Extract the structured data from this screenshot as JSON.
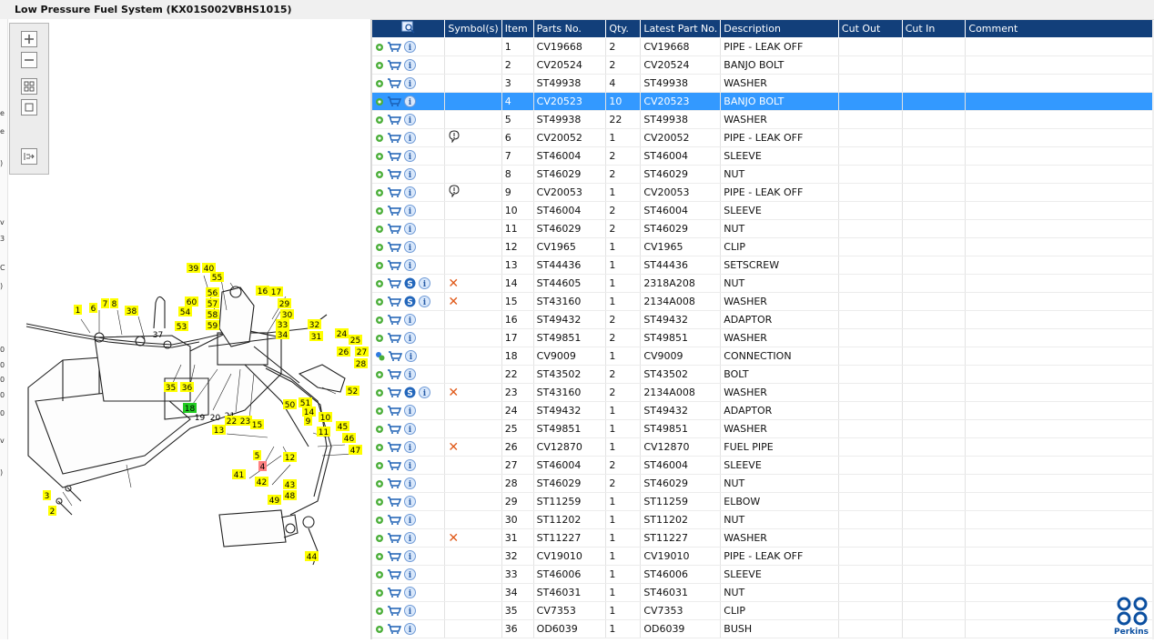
{
  "window": {
    "title": "Low Pressure Fuel System (KX01S002VBHS1015)"
  },
  "left_edge_glyphs": [
    "e",
    "e",
    ")",
    "v",
    "3",
    "C",
    ")",
    "0",
    "0",
    "0",
    "0",
    "0",
    "v",
    ")"
  ],
  "toolbar": {
    "zoom_in_icon": "zoom-in-icon",
    "zoom_out_icon": "zoom-out-icon",
    "fit_icon": "fit-all-icon",
    "actual_size_icon": "actual-size-icon",
    "export_icon": "export-icon"
  },
  "diagram": {
    "callouts": [
      "1",
      "2",
      "3",
      "4",
      "5",
      "6",
      "7",
      "8",
      "9",
      "10",
      "11",
      "12",
      "13",
      "14",
      "15",
      "16",
      "17",
      "18",
      "19",
      "20",
      "21",
      "22",
      "23",
      "24",
      "25",
      "26",
      "27",
      "28",
      "29",
      "30",
      "31",
      "32",
      "33",
      "34",
      "35",
      "36",
      "37",
      "38",
      "39",
      "40",
      "41",
      "42",
      "43",
      "44",
      "45",
      "46",
      "47",
      "48",
      "49",
      "50",
      "51",
      "52",
      "53",
      "54",
      "55",
      "56",
      "57",
      "58",
      "59",
      "60"
    ],
    "highlight_green": "18",
    "highlight_red": "4"
  },
  "table": {
    "columns": [
      "",
      "Symbol(s)",
      "Item",
      "Parts No.",
      "Qty.",
      "Latest Part No.",
      "Description",
      "Cut Out",
      "Cut In",
      "Comment"
    ],
    "header_icon": "search-icon",
    "selected_item": "4",
    "rows": [
      {
        "item": "1",
        "part": "CV19668",
        "qty": "2",
        "latest": "CV19668",
        "desc": "PIPE - LEAK OFF",
        "sym": "",
        "s": false
      },
      {
        "item": "2",
        "part": "CV20524",
        "qty": "2",
        "latest": "CV20524",
        "desc": "BANJO BOLT",
        "sym": "",
        "s": false
      },
      {
        "item": "3",
        "part": "ST49938",
        "qty": "4",
        "latest": "ST49938",
        "desc": "WASHER",
        "sym": "",
        "s": false
      },
      {
        "item": "4",
        "part": "CV20523",
        "qty": "10",
        "latest": "CV20523",
        "desc": "BANJO BOLT",
        "sym": "",
        "s": false
      },
      {
        "item": "5",
        "part": "ST49938",
        "qty": "22",
        "latest": "ST49938",
        "desc": "WASHER",
        "sym": "",
        "s": false
      },
      {
        "item": "6",
        "part": "CV20052",
        "qty": "1",
        "latest": "CV20052",
        "desc": "PIPE - LEAK OFF",
        "sym": "note",
        "s": false
      },
      {
        "item": "7",
        "part": "ST46004",
        "qty": "2",
        "latest": "ST46004",
        "desc": "SLEEVE",
        "sym": "",
        "s": false
      },
      {
        "item": "8",
        "part": "ST46029",
        "qty": "2",
        "latest": "ST46029",
        "desc": "NUT",
        "sym": "",
        "s": false
      },
      {
        "item": "9",
        "part": "CV20053",
        "qty": "1",
        "latest": "CV20053",
        "desc": "PIPE - LEAK OFF",
        "sym": "note",
        "s": false
      },
      {
        "item": "10",
        "part": "ST46004",
        "qty": "2",
        "latest": "ST46004",
        "desc": "SLEEVE",
        "sym": "",
        "s": false
      },
      {
        "item": "11",
        "part": "ST46029",
        "qty": "2",
        "latest": "ST46029",
        "desc": "NUT",
        "sym": "",
        "s": false
      },
      {
        "item": "12",
        "part": "CV1965",
        "qty": "1",
        "latest": "CV1965",
        "desc": "CLIP",
        "sym": "",
        "s": false
      },
      {
        "item": "13",
        "part": "ST44436",
        "qty": "1",
        "latest": "ST44436",
        "desc": "SETSCREW",
        "sym": "",
        "s": false
      },
      {
        "item": "14",
        "part": "ST44605",
        "qty": "1",
        "latest": "2318A208",
        "desc": "NUT",
        "sym": "x",
        "s": true
      },
      {
        "item": "15",
        "part": "ST43160",
        "qty": "1",
        "latest": "2134A008",
        "desc": "WASHER",
        "sym": "x",
        "s": true
      },
      {
        "item": "16",
        "part": "ST49432",
        "qty": "2",
        "latest": "ST49432",
        "desc": "ADAPTOR",
        "sym": "",
        "s": false
      },
      {
        "item": "17",
        "part": "ST49851",
        "qty": "2",
        "latest": "ST49851",
        "desc": "WASHER",
        "sym": "",
        "s": false
      },
      {
        "item": "18",
        "part": "CV9009",
        "qty": "1",
        "latest": "CV9009",
        "desc": "CONNECTION",
        "sym": "",
        "s": false,
        "gear2": true
      },
      {
        "item": "22",
        "part": "ST43502",
        "qty": "2",
        "latest": "ST43502",
        "desc": "BOLT",
        "sym": "",
        "s": false
      },
      {
        "item": "23",
        "part": "ST43160",
        "qty": "2",
        "latest": "2134A008",
        "desc": "WASHER",
        "sym": "x",
        "s": true
      },
      {
        "item": "24",
        "part": "ST49432",
        "qty": "1",
        "latest": "ST49432",
        "desc": "ADAPTOR",
        "sym": "",
        "s": false
      },
      {
        "item": "25",
        "part": "ST49851",
        "qty": "1",
        "latest": "ST49851",
        "desc": "WASHER",
        "sym": "",
        "s": false
      },
      {
        "item": "26",
        "part": "CV12870",
        "qty": "1",
        "latest": "CV12870",
        "desc": "FUEL PIPE",
        "sym": "x",
        "s": false
      },
      {
        "item": "27",
        "part": "ST46004",
        "qty": "2",
        "latest": "ST46004",
        "desc": "SLEEVE",
        "sym": "",
        "s": false
      },
      {
        "item": "28",
        "part": "ST46029",
        "qty": "2",
        "latest": "ST46029",
        "desc": "NUT",
        "sym": "",
        "s": false
      },
      {
        "item": "29",
        "part": "ST11259",
        "qty": "1",
        "latest": "ST11259",
        "desc": "ELBOW",
        "sym": "",
        "s": false
      },
      {
        "item": "30",
        "part": "ST11202",
        "qty": "1",
        "latest": "ST11202",
        "desc": "NUT",
        "sym": "",
        "s": false
      },
      {
        "item": "31",
        "part": "ST11227",
        "qty": "1",
        "latest": "ST11227",
        "desc": "WASHER",
        "sym": "x",
        "s": false
      },
      {
        "item": "32",
        "part": "CV19010",
        "qty": "1",
        "latest": "CV19010",
        "desc": "PIPE - LEAK OFF",
        "sym": "",
        "s": false
      },
      {
        "item": "33",
        "part": "ST46006",
        "qty": "1",
        "latest": "ST46006",
        "desc": "SLEEVE",
        "sym": "",
        "s": false
      },
      {
        "item": "34",
        "part": "ST46031",
        "qty": "1",
        "latest": "ST46031",
        "desc": "NUT",
        "sym": "",
        "s": false
      },
      {
        "item": "35",
        "part": "CV7353",
        "qty": "1",
        "latest": "CV7353",
        "desc": "CLIP",
        "sym": "",
        "s": false
      },
      {
        "item": "36",
        "part": "OD6039",
        "qty": "1",
        "latest": "OD6039",
        "desc": "BUSH",
        "sym": "",
        "s": false
      }
    ]
  },
  "brand": {
    "name": "Perkins",
    "color": "#0b4fa0"
  },
  "colors": {
    "header_bg": "#123f7a",
    "selected_row": "#3399ff",
    "callout_yellow": "#ffff00",
    "callout_green": "#22cc22",
    "callout_red": "#ff8080"
  }
}
